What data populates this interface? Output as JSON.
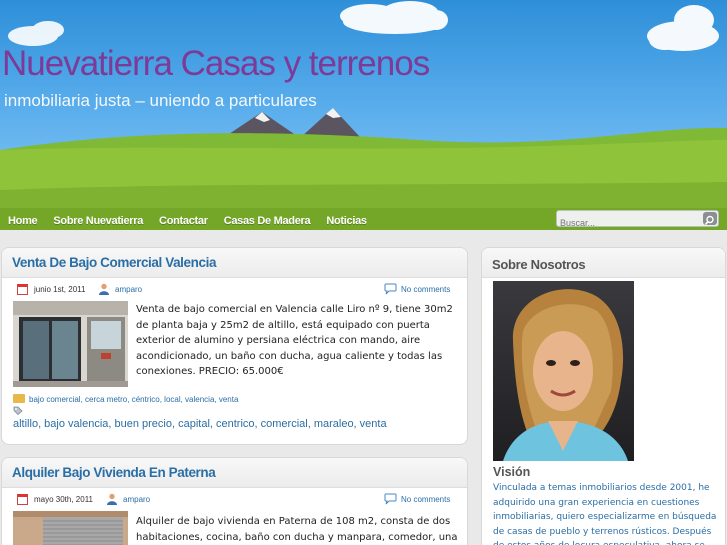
{
  "site": {
    "title": "Nuevatierra Casas y terrenos",
    "tagline": "inmobiliaria justa – uniendo a particulares"
  },
  "nav": {
    "items": [
      "Home",
      "Sobre Nuevatierra",
      "Contactar",
      "Casas De Madera",
      "Noticias"
    ]
  },
  "search": {
    "placeholder": "Buscar..."
  },
  "posts": [
    {
      "title": "Venta De Bajo Comercial Valencia",
      "date": "junio 1st, 2011",
      "author": "amparo",
      "comments": "No comments",
      "excerpt": "Venta de bajo comercial en Valencia calle Liro nº 9, tiene 30m2 de planta baja y 25m2 de altillo, está equipado con puerta exterior de alumino y persiana eléctrica con mando, aire acondicionado, un baño con ducha, agua caliente y todas las conexiones. PRECIO: 65.000€",
      "categories": "bajo comercial, cerca metro, céntrico, local, valencia, venta",
      "tags": "altillo, bajo valencia, buen precio, capital, centrico, comercial, maraleo, venta"
    },
    {
      "title": "Alquiler Bajo Vivienda En Paterna",
      "date": "mayo 30th, 2011",
      "author": "amparo",
      "comments": "No comments",
      "excerpt": "Alquiler de bajo vivienda en Paterna de 108 m2, consta de dos habitaciones, cocina, baño con ducha y manpara, comedor, una"
    }
  ],
  "sidebar": {
    "heading": "Sobre Nosotros",
    "vision_title": "Visión",
    "vision_text": "Vinculada a temas inmobiliarios desde 2001, he adquirido una gran experiencia en cuestiones inmobiliarias, quiero especializarme en búsqueda de casas de pueblo y terrenos rústicos. Después de estos años de locura especulativa, ahora se"
  },
  "colors": {
    "title": "#7d3a96",
    "link": "#2a6ea6",
    "sky": "#58acec",
    "grass": "#8fc43a"
  }
}
